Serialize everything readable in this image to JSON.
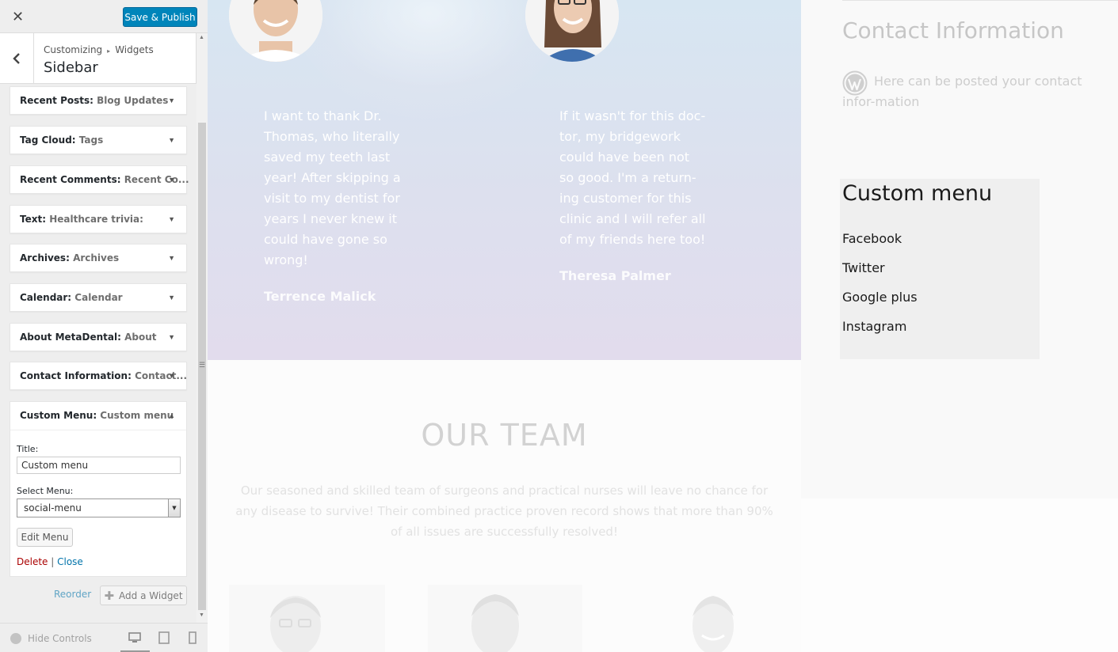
{
  "customizer": {
    "close_glyph": "✕",
    "save_label": "Save & Publish",
    "breadcrumb_root": "Customizing",
    "breadcrumb_sep": "▸",
    "breadcrumb_leaf": "Widgets",
    "section_title": "Sidebar",
    "widgets": [
      {
        "type": "Recent Posts:",
        "name": " Blog Updates"
      },
      {
        "type": "Tag Cloud:",
        "name": " Tags"
      },
      {
        "type": "Recent Comments:",
        "name": " Recent Co..."
      },
      {
        "type": "Text:",
        "name": " Healthcare trivia:"
      },
      {
        "type": "Archives:",
        "name": " Archives"
      },
      {
        "type": "Calendar:",
        "name": " Calendar"
      },
      {
        "type": "About MetaDental:",
        "name": " About"
      },
      {
        "type": "Contact Information:",
        "name": " Contact..."
      }
    ],
    "open_widget": {
      "type": "Custom Menu:",
      "name": " Custom menu",
      "title_label": "Title:",
      "title_value": "Custom menu",
      "select_label": "Select Menu:",
      "select_value": "social-menu",
      "edit_menu_label": "Edit Menu",
      "delete_label": "Delete",
      "separator": " | ",
      "close_label": "Close"
    },
    "reorder_label": "Reorder",
    "add_widget_label": "Add a Widget",
    "hide_controls_label": "Hide Controls"
  },
  "preview": {
    "testimonials": [
      {
        "text": "I want to thank Dr.\nThomas, who literally\nsaved my teeth last\nyear! After skipping a\nvisit to my dentist for\nyears I never knew it\ncould have gone so\nwrong!",
        "author": "Terrence Malick"
      },
      {
        "text": "If it wasn't for this doc-\ntor, my bridgework\ncould have been not\nso good. I'm a return-\ning customer for this\nclinic and I will refer all\nof my friends here too!",
        "author": "Theresa Palmer"
      }
    ],
    "team_title": "OUR TEAM",
    "team_description": "Our seasoned and skilled team of surgeons and practical nurses will leave no chance for any disease to survive! Their combined practice proven record shows that more than 90% of all issues are successfully resolved!",
    "contact_title": "Contact Information",
    "contact_text": "Here can be posted your contact infor-mation",
    "custom_menu_title": "Custom menu",
    "custom_menu_items": [
      "Facebook",
      "Twitter",
      "Google plus",
      "Instagram"
    ]
  },
  "colors": {
    "accent": "#0085ba",
    "link": "#0073aa",
    "delete": "#aa0000"
  }
}
